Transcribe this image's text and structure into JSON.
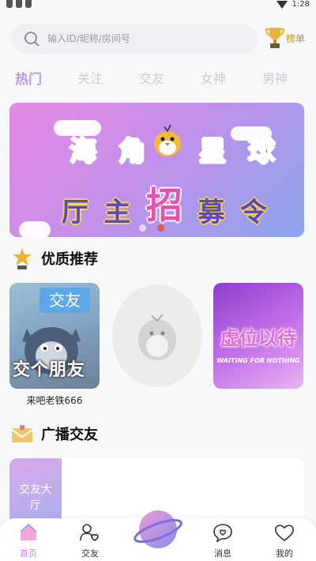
{
  "status_bar": {
    "time": "1:28",
    "wifi_icon": "wifi-icon"
  },
  "search": {
    "placeholder": "输入ID/昵称/房间号",
    "icon": "search-icon"
  },
  "rank": {
    "label": "榜单",
    "icon": "trophy-icon"
  },
  "tabs": [
    {
      "label": "热门",
      "active": true
    },
    {
      "label": "关注",
      "active": false
    },
    {
      "label": "交友",
      "active": false
    },
    {
      "label": "女神",
      "active": false
    },
    {
      "label": "男神",
      "active": false
    }
  ],
  "banner": {
    "line1": [
      "海",
      "角",
      "星",
      "球"
    ],
    "line2": [
      "厅",
      "主",
      "招",
      "募",
      "令"
    ],
    "dots": 2,
    "active_dot": 1
  },
  "recommend": {
    "title": "优质推荐",
    "icon": "star-trophy-icon",
    "cards": [
      {
        "tag": "交友",
        "caption": "交个朋友",
        "name": "来吧老铁666"
      },
      {
        "name": ""
      },
      {
        "caption": "虚位以待",
        "subcaption": "WAITING FOR NOTHING",
        "name": ""
      }
    ]
  },
  "broadcast": {
    "title": "广播交友",
    "icon": "envelope-icon",
    "thumb_label": "交友大厅"
  },
  "bottom_nav": [
    {
      "label": "首页",
      "icon": "home-icon",
      "active": true
    },
    {
      "label": "交友",
      "icon": "friends-icon",
      "active": false
    },
    {
      "label": "",
      "icon": "planet-icon",
      "active": false
    },
    {
      "label": "消息",
      "icon": "message-icon",
      "active": false
    },
    {
      "label": "我的",
      "icon": "profile-heart-icon",
      "active": false
    }
  ],
  "colors": {
    "accent": "#b69ae6",
    "active_nav": "#d07fe0",
    "dot_active": "#e0585f",
    "rank_gold": "#c59a1b"
  }
}
